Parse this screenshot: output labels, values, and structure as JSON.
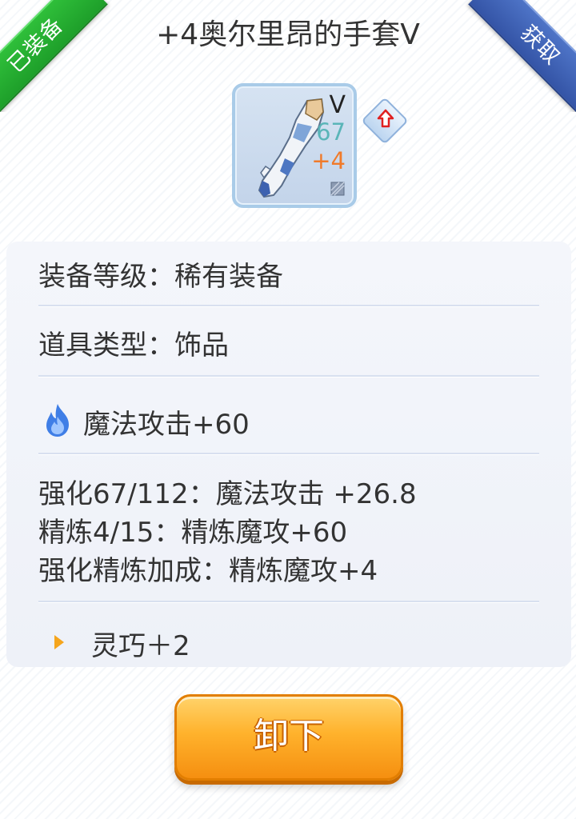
{
  "ribbons": {
    "equipped": "已装备",
    "obtain": "获取"
  },
  "title": "+4奥尔里昂的手套V",
  "item": {
    "tier": "V",
    "enhance_level": "67",
    "refine": "+4",
    "icon": "glove-icon"
  },
  "upgrade_icon": "arrow-up-icon",
  "info": {
    "grade": "装备等级：稀有装备",
    "type": "道具类型：饰品",
    "base_stat": "魔法攻击+60",
    "enhance": "强化67/112：魔法攻击 +26.8",
    "refine": "精炼4/15：精炼魔攻+60",
    "bonus": "强化精炼加成：精炼魔攻+4",
    "extra": "灵巧＋2"
  },
  "button": {
    "unequip": "卸下"
  },
  "colors": {
    "green_ribbon": "#1e9f2a",
    "blue_ribbon": "#3454a6",
    "button_orange": "#ffb22c",
    "refine_text": "#f07a2a",
    "level_text": "#5ab5b8"
  }
}
